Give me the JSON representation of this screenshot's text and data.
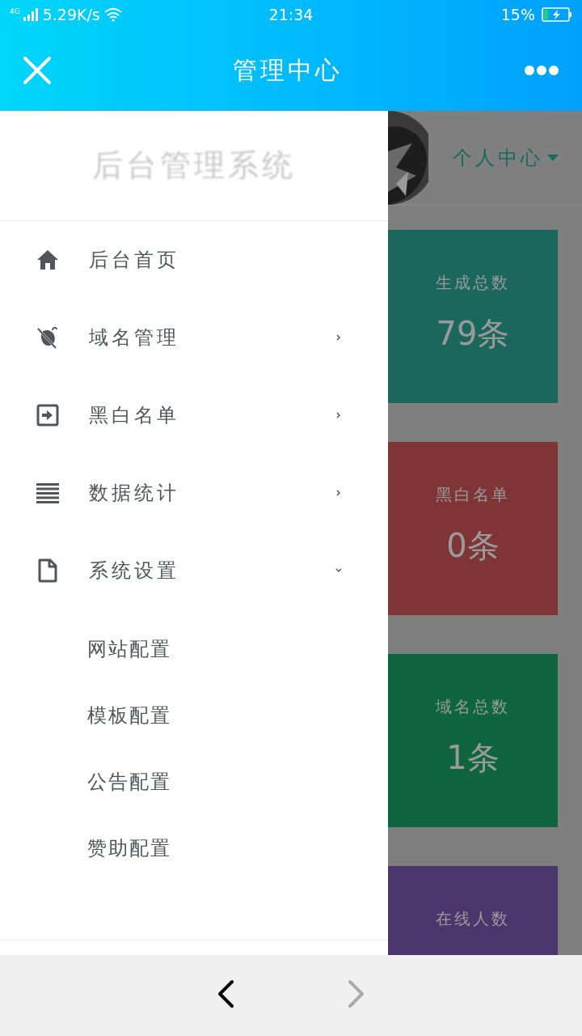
{
  "status_bar": {
    "network": "4G",
    "speed": "5.29K/s",
    "time": "21:34",
    "battery": "15%"
  },
  "header": {
    "title": "管理中心"
  },
  "drawer": {
    "title": "后台管理系统",
    "items": [
      {
        "label": "后台首页",
        "kind": "link"
      },
      {
        "label": "域名管理",
        "kind": "group",
        "expanded": false
      },
      {
        "label": "黑白名单",
        "kind": "group",
        "expanded": false
      },
      {
        "label": "数据统计",
        "kind": "group",
        "expanded": false
      },
      {
        "label": "系统设置",
        "kind": "group",
        "expanded": true,
        "children": [
          {
            "label": "网站配置"
          },
          {
            "label": "模板配置"
          },
          {
            "label": "公告配置"
          },
          {
            "label": "赞助配置"
          }
        ]
      }
    ]
  },
  "page": {
    "profile_menu": "个人中心",
    "cards": [
      {
        "label": "生成总数",
        "value": "79条",
        "color": "#1b675d"
      },
      {
        "label": "黑白名单",
        "value": "0条",
        "color": "#7f3535"
      },
      {
        "label": "域名总数",
        "value": "1条",
        "color": "#0e6540"
      },
      {
        "label": "在线人数",
        "color": "#4a356c"
      }
    ]
  },
  "bottom_nav": {
    "back": {
      "disabled": false
    },
    "forward": {
      "disabled": true
    }
  }
}
